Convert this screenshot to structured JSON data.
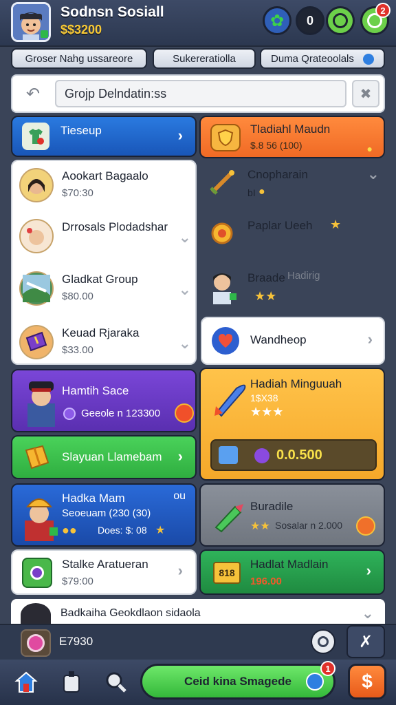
{
  "header": {
    "title": "Sodnsn Sosiall",
    "coins": "$$3200",
    "friend_badge": "0",
    "notif_badge": "2"
  },
  "tabs": [
    {
      "label": "Groser Nahg ussareore"
    },
    {
      "label": "Sukereratiolla"
    },
    {
      "label": "Duma Qrateoolals"
    }
  ],
  "search": {
    "value": "Grojp Delndatin:ss"
  },
  "left_top": {
    "title": "Tieseup"
  },
  "right_top": {
    "title": "Tladiahl Maudn",
    "sub": "$.8 56 (100)"
  },
  "list_items": [
    {
      "title": "Aookart Bagaalo",
      "sub": "$70:30"
    },
    {
      "title": "Drrosals Plodadshar",
      "sub": ""
    },
    {
      "title": "Gladkat Group",
      "sub": "$80.00"
    },
    {
      "title": "Keuad Rjaraka",
      "sub": "$33.00"
    }
  ],
  "right_items": [
    {
      "title": "Cnopharain",
      "sub": "bI"
    },
    {
      "title": "Paplar Ueeh",
      "sub": ""
    },
    {
      "title": "Braade",
      "extra": "Hadirig"
    }
  ],
  "wandheop": {
    "title": "Wandheop"
  },
  "purple_card": {
    "title": "Hamtih Sace",
    "sub": "Geeole n 123300"
  },
  "green_card": {
    "title": "Slayuan Llamebam"
  },
  "orange_big": {
    "title": "Hadiah Minguuah",
    "sub": "1$X38",
    "amount": "0.0.500"
  },
  "blue_card": {
    "title": "Hadka Mam",
    "sub": "Seoeuam (230 (30)",
    "extra": "Does: $: 08",
    "corner": "ou"
  },
  "gray_card": {
    "title": "Buradile",
    "sub": "Sosalar n 2.000"
  },
  "white_card": {
    "title": "Stalke Aratueran",
    "sub": "$79:00"
  },
  "green_dark_card": {
    "title": "Hadlat Madlain",
    "sub": "196.00",
    "badge": "818"
  },
  "notice_bar": {
    "title": "Badkaiha Geokdlaon sidaola"
  },
  "bottom_status": {
    "value": "E7930"
  },
  "cta": {
    "label": "Ceid kina Smagede",
    "badge": "1"
  },
  "colors": {
    "accent_blue": "#1b64c8",
    "accent_orange": "#f58a30",
    "accent_green": "#34c24a",
    "accent_purple": "#6a3fc4"
  }
}
